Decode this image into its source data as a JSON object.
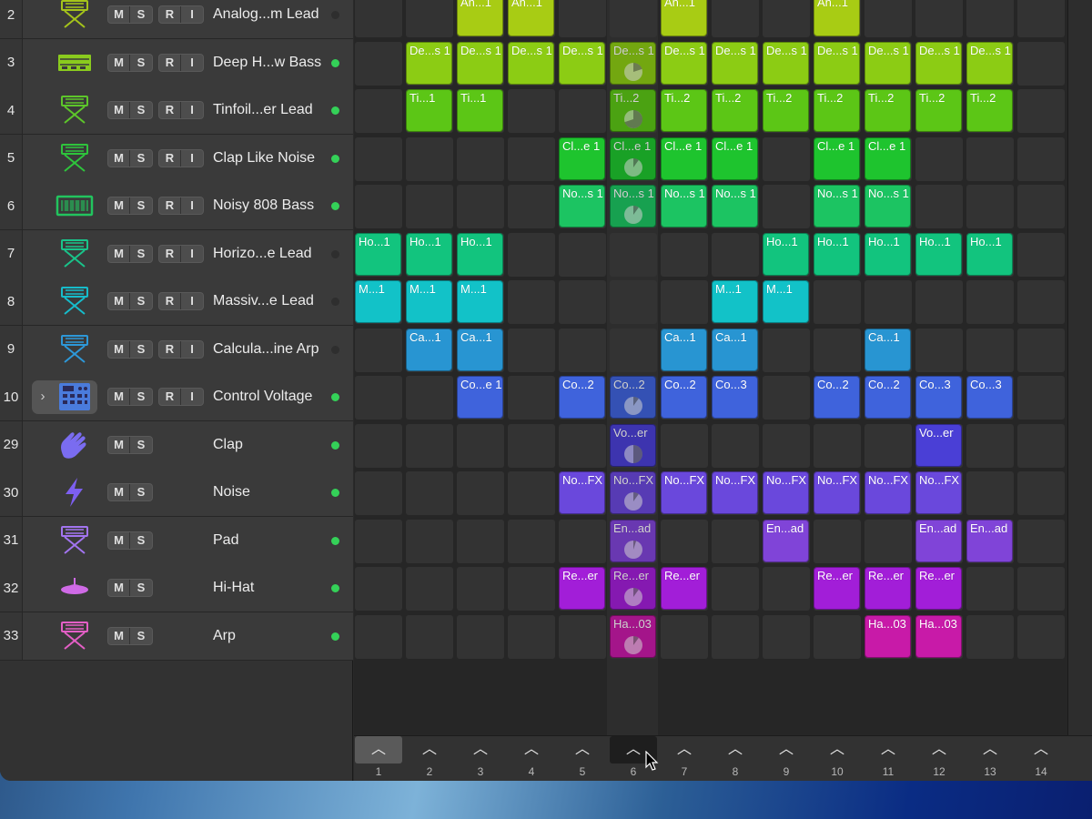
{
  "colors": {
    "active_dot": "#34d158",
    "inactive_dot": "#2e2e2e"
  },
  "tracks": [
    {
      "num": "2",
      "name": "Analog...m Lead",
      "icon": "keyboard-stand-icon",
      "color": "#a5c41a",
      "buttons": [
        "M",
        "S",
        "R",
        "I"
      ],
      "active": false
    },
    {
      "num": "3",
      "name": "Deep H...w Bass",
      "icon": "synth-module-icon",
      "color": "#8acb1e",
      "buttons": [
        "M",
        "S",
        "R",
        "I"
      ],
      "active": true
    },
    {
      "num": "4",
      "name": "Tinfoil...er Lead",
      "icon": "keyboard-stand-icon",
      "color": "#5dc62a",
      "buttons": [
        "M",
        "S",
        "R",
        "I"
      ],
      "active": true
    },
    {
      "num": "5",
      "name": "Clap Like Noise",
      "icon": "keyboard-stand-icon",
      "color": "#2ec43c",
      "buttons": [
        "M",
        "S",
        "R",
        "I"
      ],
      "active": true
    },
    {
      "num": "6",
      "name": "Noisy 808 Bass",
      "icon": "synth-rack-icon",
      "color": "#22c45e",
      "buttons": [
        "M",
        "S",
        "R",
        "I"
      ],
      "active": true
    },
    {
      "num": "7",
      "name": "Horizo...e Lead",
      "icon": "keyboard-stand-icon",
      "color": "#19c48a",
      "buttons": [
        "M",
        "S",
        "R",
        "I"
      ],
      "active": false
    },
    {
      "num": "8",
      "name": "Massiv...e Lead",
      "icon": "keyboard-stand-icon",
      "color": "#16bccb",
      "buttons": [
        "M",
        "S",
        "R",
        "I"
      ],
      "active": false
    },
    {
      "num": "9",
      "name": "Calcula...ine Arp",
      "icon": "keyboard-stand-icon",
      "color": "#2d98d8",
      "buttons": [
        "M",
        "S",
        "R",
        "I"
      ],
      "active": false
    },
    {
      "num": "10",
      "name": "Control Voltage",
      "icon": "drum-machine-icon",
      "color": "#4a7bdc",
      "buttons": [
        "M",
        "S",
        "R",
        "I"
      ],
      "active": true,
      "expander": true
    },
    {
      "num": "29",
      "name": "Clap",
      "icon": "hand-clap-icon",
      "color": "#7a6cf0",
      "buttons": [
        "M",
        "S"
      ],
      "active": true
    },
    {
      "num": "30",
      "name": "Noise",
      "icon": "lightning-icon",
      "color": "#7d5ff0",
      "buttons": [
        "M",
        "S"
      ],
      "active": true
    },
    {
      "num": "31",
      "name": "Pad",
      "icon": "keyboard-stand-icon",
      "color": "#a274f0",
      "buttons": [
        "M",
        "S"
      ],
      "active": true
    },
    {
      "num": "32",
      "name": "Hi-Hat",
      "icon": "hihat-icon",
      "color": "#cf6ae6",
      "buttons": [
        "M",
        "S"
      ],
      "active": true
    },
    {
      "num": "33",
      "name": "Arp",
      "icon": "keyboard-stand-icon",
      "color": "#e45fc6",
      "buttons": [
        "M",
        "S"
      ],
      "active": true
    }
  ],
  "clip_rows": [
    {
      "color": "#a8cc14",
      "clips": [
        {
          "col": 3,
          "label": "An...1"
        },
        {
          "col": 4,
          "label": "An...1"
        },
        {
          "col": 7,
          "label": "An...1"
        },
        {
          "col": 10,
          "label": "An...1"
        }
      ]
    },
    {
      "color": "#8ccc14",
      "clips": [
        {
          "col": 2,
          "label": "De...s 1"
        },
        {
          "col": 3,
          "label": "De...s 1"
        },
        {
          "col": 4,
          "label": "De...s 1"
        },
        {
          "col": 5,
          "label": "De...s 1"
        },
        {
          "col": 6,
          "label": "De...s 1",
          "progress": 0.2
        },
        {
          "col": 7,
          "label": "De...s 1"
        },
        {
          "col": 8,
          "label": "De...s 1"
        },
        {
          "col": 9,
          "label": "De...s 1"
        },
        {
          "col": 10,
          "label": "De...s 1"
        },
        {
          "col": 11,
          "label": "De...s 1"
        },
        {
          "col": 12,
          "label": "De...s 1"
        },
        {
          "col": 13,
          "label": "De...s 1"
        }
      ]
    },
    {
      "color": "#5cc616",
      "clips": [
        {
          "col": 2,
          "label": "Ti...1"
        },
        {
          "col": 3,
          "label": "Ti...1"
        },
        {
          "col": 6,
          "label": "Ti...2",
          "progress": 0.7
        },
        {
          "col": 7,
          "label": "Ti...2"
        },
        {
          "col": 8,
          "label": "Ti...2"
        },
        {
          "col": 9,
          "label": "Ti...2"
        },
        {
          "col": 10,
          "label": "Ti...2"
        },
        {
          "col": 11,
          "label": "Ti...2"
        },
        {
          "col": 12,
          "label": "Ti...2"
        },
        {
          "col": 13,
          "label": "Ti...2"
        }
      ]
    },
    {
      "color": "#1ec42e",
      "clips": [
        {
          "col": 5,
          "label": "Cl...e 1"
        },
        {
          "col": 6,
          "label": "Cl...e 1",
          "progress": 0.1
        },
        {
          "col": 7,
          "label": "Cl...e 1"
        },
        {
          "col": 8,
          "label": "Cl...e 1"
        },
        {
          "col": 10,
          "label": "Cl...e 1"
        },
        {
          "col": 11,
          "label": "Cl...e 1"
        }
      ]
    },
    {
      "color": "#1cc462",
      "clips": [
        {
          "col": 5,
          "label": "No...s 1"
        },
        {
          "col": 6,
          "label": "No...s 1",
          "progress": 0.1
        },
        {
          "col": 7,
          "label": "No...s 1"
        },
        {
          "col": 8,
          "label": "No...s 1"
        },
        {
          "col": 10,
          "label": "No...s 1"
        },
        {
          "col": 11,
          "label": "No...s 1"
        }
      ]
    },
    {
      "color": "#12c47e",
      "clips": [
        {
          "col": 1,
          "label": "Ho...1"
        },
        {
          "col": 2,
          "label": "Ho...1"
        },
        {
          "col": 3,
          "label": "Ho...1"
        },
        {
          "col": 9,
          "label": "Ho...1"
        },
        {
          "col": 10,
          "label": "Ho...1"
        },
        {
          "col": 11,
          "label": "Ho...1"
        },
        {
          "col": 12,
          "label": "Ho...1"
        },
        {
          "col": 13,
          "label": "Ho...1"
        }
      ]
    },
    {
      "color": "#12c2c8",
      "clips": [
        {
          "col": 1,
          "label": "M...1"
        },
        {
          "col": 2,
          "label": "M...1"
        },
        {
          "col": 3,
          "label": "M...1"
        },
        {
          "col": 8,
          "label": "M...1"
        },
        {
          "col": 9,
          "label": "M...1"
        }
      ]
    },
    {
      "color": "#2895d2",
      "clips": [
        {
          "col": 2,
          "label": "Ca...1"
        },
        {
          "col": 3,
          "label": "Ca...1"
        },
        {
          "col": 7,
          "label": "Ca...1"
        },
        {
          "col": 8,
          "label": "Ca...1"
        },
        {
          "col": 11,
          "label": "Ca...1"
        }
      ]
    },
    {
      "color": "#3f63dc",
      "clips": [
        {
          "col": 3,
          "label": "Co...e 1"
        },
        {
          "col": 5,
          "label": "Co...2"
        },
        {
          "col": 6,
          "label": "Co...2",
          "progress": 0.1
        },
        {
          "col": 7,
          "label": "Co...2"
        },
        {
          "col": 8,
          "label": "Co...3"
        },
        {
          "col": 10,
          "label": "Co...2"
        },
        {
          "col": 11,
          "label": "Co...2"
        },
        {
          "col": 12,
          "label": "Co...3"
        },
        {
          "col": 13,
          "label": "Co...3"
        }
      ]
    },
    {
      "color": "#4a3fd6",
      "clips": [
        {
          "col": 6,
          "label": "Vo...er",
          "progress": 0.5
        },
        {
          "col": 12,
          "label": "Vo...er"
        }
      ]
    },
    {
      "color": "#6a48dc",
      "clips": [
        {
          "col": 5,
          "label": "No...FX"
        },
        {
          "col": 6,
          "label": "No...FX",
          "progress": 0.1
        },
        {
          "col": 7,
          "label": "No...FX"
        },
        {
          "col": 8,
          "label": "No...FX"
        },
        {
          "col": 9,
          "label": "No...FX"
        },
        {
          "col": 10,
          "label": "No...FX"
        },
        {
          "col": 11,
          "label": "No...FX"
        },
        {
          "col": 12,
          "label": "No...FX"
        }
      ]
    },
    {
      "color": "#8044d8",
      "clips": [
        {
          "col": 6,
          "label": "En...ad",
          "progress": 0.05
        },
        {
          "col": 9,
          "label": "En...ad"
        },
        {
          "col": 12,
          "label": "En...ad"
        },
        {
          "col": 13,
          "label": "En...ad"
        }
      ]
    },
    {
      "color": "#a21ed8",
      "clips": [
        {
          "col": 5,
          "label": "Re...er"
        },
        {
          "col": 6,
          "label": "Re...er",
          "progress": 0.1
        },
        {
          "col": 7,
          "label": "Re...er"
        },
        {
          "col": 10,
          "label": "Re...er"
        },
        {
          "col": 11,
          "label": "Re...er"
        },
        {
          "col": 12,
          "label": "Re...er"
        }
      ]
    },
    {
      "color": "#c81aa8",
      "clips": [
        {
          "col": 6,
          "label": "Ha...03",
          "progress": 0.1
        },
        {
          "col": 11,
          "label": "Ha...03"
        },
        {
          "col": 12,
          "label": "Ha...03"
        }
      ]
    }
  ],
  "scenes": [
    "1",
    "2",
    "3",
    "4",
    "5",
    "6",
    "7",
    "8",
    "9",
    "10",
    "11",
    "12",
    "13",
    "14"
  ],
  "scene_launch_glyph": "︿",
  "selected_scene": 1,
  "playing_scene": 6
}
